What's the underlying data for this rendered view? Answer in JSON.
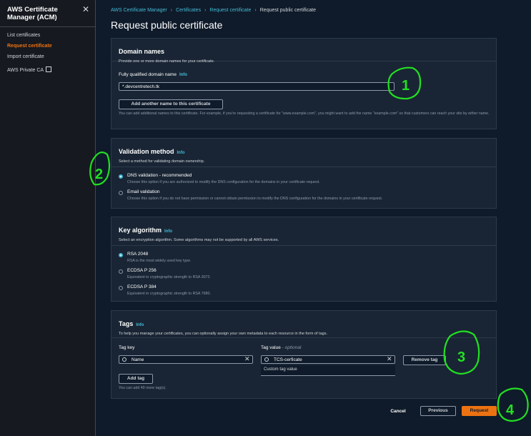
{
  "sidebar": {
    "title": "AWS Certificate Manager (ACM)",
    "close": "✕",
    "items": [
      {
        "label": "List certificates"
      },
      {
        "label": "Request certificate"
      },
      {
        "label": "Import certificate"
      },
      {
        "label": "AWS Private CA"
      }
    ]
  },
  "breadcrumb": [
    "AWS Certificate Manager",
    "Certificates",
    "Request certificate",
    "Request public certificate"
  ],
  "breadcrumb_sep": "›",
  "page_title": "Request public certificate",
  "info_label": "Info",
  "domain_names": {
    "title": "Domain names",
    "desc": "Provide one or more domain names for your certificate.",
    "field_label": "Fully qualified domain name",
    "value": "*.devcentretech.tk",
    "add_button": "Add another name to this certificate",
    "help": "You can add additional names to this certificate. For example, if you're requesting a certificate for \"www.example.com\", you might want to add the name \"example.com\" so that customers can reach your site by either name."
  },
  "validation": {
    "title": "Validation method",
    "desc": "Select a method for validating domain ownership.",
    "options": [
      {
        "label": "DNS validation - recommended",
        "desc": "Choose this option if you are authorized to modify the DNS configuration for the domains in your certificate request."
      },
      {
        "label": "Email validation",
        "desc": "Choose this option if you do not have permission or cannot obtain permission to modify the DNS configuration for the domains in your certificate request."
      }
    ]
  },
  "key_algorithm": {
    "title": "Key algorithm",
    "desc": "Select an encryption algorithm. Some algorithms may not be supported by all AWS services.",
    "options": [
      {
        "label": "RSA 2048",
        "desc": "RSA is the most widely used key type."
      },
      {
        "label": "ECDSA P 256",
        "desc": "Equivalent in cryptographic strength to RSA 3072."
      },
      {
        "label": "ECDSA P 384",
        "desc": "Equivalent in cryptographic strength to RSA 7680."
      }
    ]
  },
  "tags": {
    "title": "Tags",
    "desc": "To help you manage your certificates, you can optionally assign your own metadata to each resource in the form of tags.",
    "key_label": "Tag key",
    "value_label": "Tag value",
    "value_optional": "- optional",
    "key_value": "Name",
    "value_value": "TCS-cerficate",
    "dropdown_option": "Custom tag value",
    "remove_button": "Remove tag",
    "add_button": "Add tag",
    "remaining": "You can add 49 more tag(s)."
  },
  "footer": {
    "cancel": "Cancel",
    "previous": "Previous",
    "request": "Request"
  },
  "annotations": [
    "1",
    "2",
    "3",
    "4"
  ],
  "colors": {
    "accent": "#ec7211",
    "link": "#44b9d6",
    "annotation": "#22e022"
  }
}
